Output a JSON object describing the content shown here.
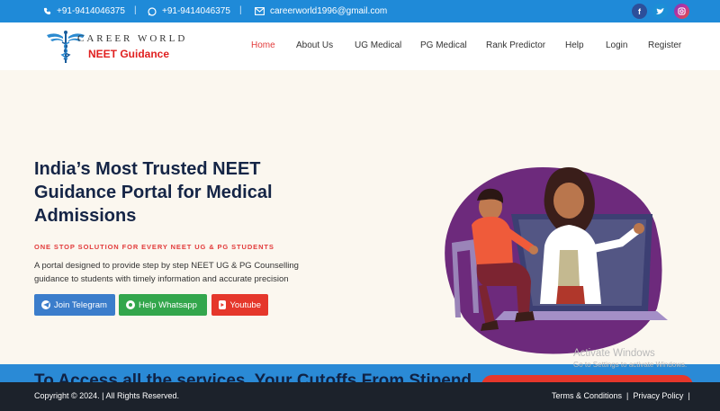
{
  "topbar": {
    "phone1": "+91-9414046375",
    "whatsapp": "+91-9414046375",
    "email": "careerworld1996@gmail.com",
    "separator": "|",
    "social": [
      "facebook-icon",
      "twitter-icon",
      "instagram-icon"
    ]
  },
  "logo": {
    "line1": "CAREER WORLD",
    "line2": "NEET Guidance"
  },
  "nav": {
    "items": [
      "Home",
      "About Us",
      "UG Medical",
      "PG Medical",
      "Rank Predictor",
      "Help",
      "Login",
      "Register"
    ],
    "active": "Home"
  },
  "hero": {
    "headline": "India’s Most Trusted NEET Guidance Portal for Medical Admissions",
    "tagline": "ONE STOP SOLUTION FOR EVERY NEET UG & PG STUDENTS",
    "description": "A portal designed to provide step by step NEET UG & PG Counselling guidance to students with timely information and accurate precision",
    "buttons": {
      "telegram": "Join Telegram",
      "whatsapp": "Help Whatsapp",
      "youtube": "Youtube"
    }
  },
  "banner": {
    "partial_text": "To Access all the services, Your Cutoffs From Stipend"
  },
  "footer": {
    "copyright": "Copyright © 2024. | All Rights Reserved.",
    "terms": "Terms & Conditions",
    "privacy": "Privacy Policy",
    "sep": "|"
  },
  "watermark": {
    "title": "Activate Windows",
    "subtitle": "Go to Settings to activate Windows."
  },
  "colors": {
    "topbar": "#1f8ad8",
    "accent_red": "#e23b3b",
    "headline": "#152546",
    "telegram": "#3b7dcb",
    "whatsapp": "#33a64c",
    "youtube": "#e5372b",
    "footer": "#1c222b",
    "blob": "#6d2a7c"
  }
}
